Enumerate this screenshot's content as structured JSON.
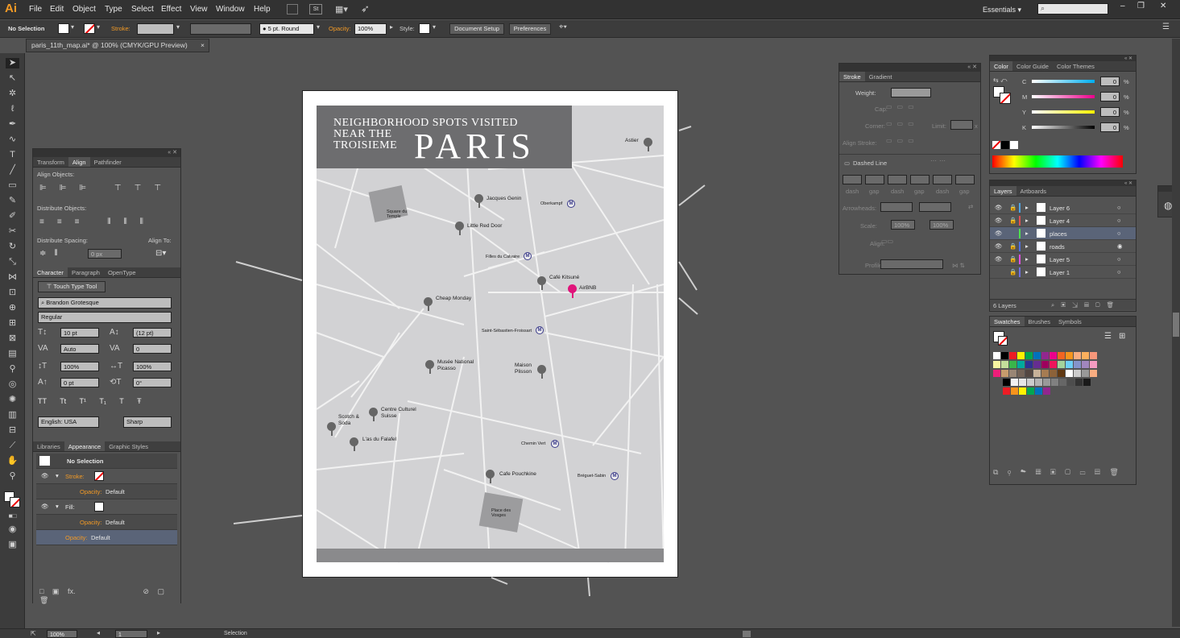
{
  "app": {
    "logo": "Ai"
  },
  "menu": [
    "File",
    "Edit",
    "Object",
    "Type",
    "Select",
    "Effect",
    "View",
    "Window",
    "Help"
  ],
  "menubar": {
    "st_badge": "St",
    "workspace": "Essentials ▾",
    "window_controls": [
      "–",
      "❐",
      "✕"
    ]
  },
  "control": {
    "selection": "No Selection",
    "stroke_label": "Stroke:",
    "brush": "5 pt. Round",
    "opacity_label": "Opacity:",
    "opacity_value": "100%",
    "style_label": "Style:",
    "doc_setup": "Document Setup",
    "preferences": "Preferences"
  },
  "document": {
    "tab": "paris_11th_map.ai* @ 100% (CMYK/GPU Preview)",
    "close": "×"
  },
  "align_panel": {
    "tabs": [
      "Transform",
      "Align",
      "Pathfinder"
    ],
    "align_objects": "Align Objects:",
    "distribute_objects": "Distribute Objects:",
    "distribute_spacing": "Distribute Spacing:",
    "align_to": "Align To:",
    "spacing_value": "0 px"
  },
  "character_panel": {
    "tabs": [
      "Character",
      "Paragraph",
      "OpenType"
    ],
    "touch_type": "Touch Type Tool",
    "font": "Brandon Grotesque",
    "style": "Regular",
    "size": "10 pt",
    "leading": "(12 pt)",
    "kerning": "Auto",
    "tracking": "0",
    "vscale": "100%",
    "hscale": "100%",
    "baseline": "0 pt",
    "rotation": "0°",
    "language": "English: USA",
    "antialias": "Sharp",
    "type_buttons": [
      "TT",
      "Tt",
      "T¹",
      "T₁",
      "T",
      "Ŧ"
    ]
  },
  "appearance_panel": {
    "tabs": [
      "Libraries",
      "Appearance",
      "Graphic Styles"
    ],
    "selection": "No Selection",
    "stroke": "Stroke:",
    "opacity": "Opacity:",
    "default": "Default",
    "fill": "Fill:"
  },
  "stroke_panel": {
    "tabs": [
      "Stroke",
      "Gradient"
    ],
    "weight": "Weight:",
    "cap": "Cap:",
    "corner": "Corner:",
    "limit": "Limit:",
    "limit_x": "x",
    "align_stroke": "Align Stroke:",
    "dashed_line": "Dashed Line",
    "dash": "dash",
    "gap": "gap",
    "arrowheads": "Arrowheads:",
    "scale": "Scale:",
    "scale_value_1": "100%",
    "scale_value_2": "100%",
    "align": "Align:",
    "profile": "Profile:"
  },
  "color_panel": {
    "tabs": [
      "Color",
      "Color Guide",
      "Color Themes"
    ],
    "channels": [
      {
        "name": "C",
        "value": "0"
      },
      {
        "name": "M",
        "value": "0"
      },
      {
        "name": "Y",
        "value": "0"
      },
      {
        "name": "K",
        "value": "0"
      }
    ],
    "percent": "%"
  },
  "layers_panel": {
    "tabs": [
      "Layers",
      "Artboards"
    ],
    "layers": [
      {
        "name": "Layer 6",
        "color": "#4fa3e0",
        "eye": true
      },
      {
        "name": "Layer 4",
        "color": "#e04f4f",
        "eye": true
      },
      {
        "name": "places",
        "color": "#4fe04f",
        "eye": true,
        "selected": true
      },
      {
        "name": "roads",
        "color": "#4f6fe0",
        "eye": true
      },
      {
        "name": "Layer 5",
        "color": "#e04fe0",
        "eye": true
      },
      {
        "name": "Layer 1",
        "color": "#6f6fe0",
        "eye": false
      }
    ],
    "count": "6 Layers"
  },
  "swatches_panel": {
    "tabs": [
      "Swatches",
      "Brushes",
      "Symbols"
    ],
    "row1": [
      "#ffffff",
      "#000000",
      "#ed1c24",
      "#fff200",
      "#00a651",
      "#0072bc",
      "#92278f",
      "#ec008c",
      "#f26522",
      "#f7941d",
      "#f9ad81",
      "#fbaf5d",
      "#f7977a"
    ],
    "row2": [
      "#f7f6a1",
      "#c4df9b",
      "#39b54a",
      "#00a99d",
      "#2e3192",
      "#662d91",
      "#9e005d",
      "#ed145b",
      "#a3d39c",
      "#6dcff6",
      "#8493ca",
      "#a186be",
      "#f49ac1"
    ],
    "row3": [
      "#ed1e79",
      "#c69c6d",
      "#998675",
      "#736357",
      "#534741",
      "#c7b299",
      "#a67c52",
      "#8c6239",
      "#603913",
      "#ffffff",
      "#cccccc",
      "#999999",
      "#f9ad81"
    ],
    "row4": [
      "#000000",
      "#f2f2f2",
      "#e6e6e6",
      "#cccccc",
      "#b3b3b3",
      "#999999",
      "#808080",
      "#666666",
      "#4d4d4d",
      "#333333",
      "#1a1a1a"
    ],
    "row5": [
      "#ed1c24",
      "#f7941d",
      "#fff200",
      "#00a651",
      "#0072bc",
      "#92278f"
    ]
  },
  "map": {
    "title_small": "NEIGHBORHOOD SPOTS VISITED",
    "title_line2": "NEAR THE",
    "title_line3": "TROISIEME",
    "title_big": "PARIS",
    "places": [
      {
        "name": "Astier",
        "pink": false
      },
      {
        "name": "Jacques Genin",
        "pink": false
      },
      {
        "name": "Little Red Door",
        "pink": false
      },
      {
        "name": "Café Kitsuné",
        "pink": false
      },
      {
        "name": "AirBNB",
        "pink": true
      },
      {
        "name": "Cheap Monday",
        "pink": false
      },
      {
        "name": "Musée National",
        "pink": false
      },
      {
        "name": "Picasso",
        "pink": false
      },
      {
        "name": "Maison",
        "pink": false
      },
      {
        "name": "Plisson",
        "pink": false
      },
      {
        "name": "Centre Culturel",
        "pink": false
      },
      {
        "name": "Suisse",
        "pink": false
      },
      {
        "name": "Scotch &",
        "pink": false
      },
      {
        "name": "Soda",
        "pink": false
      },
      {
        "name": "L'as du Falafel",
        "pink": false
      },
      {
        "name": "Cafe Pouchkine",
        "pink": false
      }
    ],
    "metros": [
      "Oberkampf",
      "Filles du Calvaire",
      "Saint-Sébastien-Froissart",
      "Chemin Vert",
      "Bréguet-Sabin"
    ],
    "metro_symbol": "M",
    "squares": [
      "Square du",
      "Temple",
      "Place des",
      "Vosges"
    ]
  },
  "status": {
    "zoom": "100%",
    "page": "1",
    "tool": "Selection"
  }
}
